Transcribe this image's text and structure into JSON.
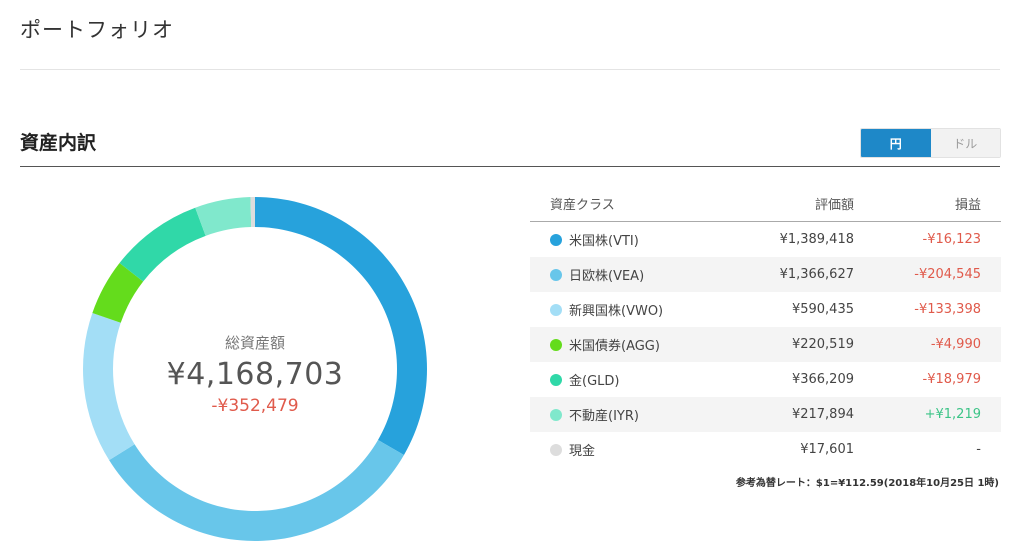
{
  "page": {
    "title": "ポートフォリオ"
  },
  "section": {
    "title": "資産内訳"
  },
  "currency_toggle": {
    "yen": "円",
    "dollar": "ドル",
    "selected": "円"
  },
  "summary": {
    "label": "総資産額",
    "total": "¥4,168,703",
    "profit_loss": "-¥352,479"
  },
  "table": {
    "headers": {
      "asset_class": "資産クラス",
      "value": "評価額",
      "profit_loss": "損益"
    },
    "rows": [
      {
        "name": "米国株(VTI)",
        "value": "¥1,389,418",
        "profit_loss": "-¥16,123",
        "color": "#27a2dc",
        "amount": 1389418,
        "pl_type": "neg"
      },
      {
        "name": "日欧株(VEA)",
        "value": "¥1,366,627",
        "profit_loss": "-¥204,545",
        "color": "#68c6ea",
        "amount": 1366627,
        "pl_type": "neg"
      },
      {
        "name": "新興国株(VWO)",
        "value": "¥590,435",
        "profit_loss": "-¥133,398",
        "color": "#a3def6",
        "amount": 590435,
        "pl_type": "neg"
      },
      {
        "name": "米国債券(AGG)",
        "value": "¥220,519",
        "profit_loss": "-¥4,990",
        "color": "#64dc1c",
        "amount": 220519,
        "pl_type": "neg"
      },
      {
        "name": "金(GLD)",
        "value": "¥366,209",
        "profit_loss": "-¥18,979",
        "color": "#30d8a8",
        "amount": 366209,
        "pl_type": "neg"
      },
      {
        "name": "不動産(IYR)",
        "value": "¥217,894",
        "profit_loss": "+¥1,219",
        "color": "#80e8cc",
        "amount": 217894,
        "pl_type": "pos"
      },
      {
        "name": "現金",
        "value": "¥17,601",
        "profit_loss": "-",
        "color": "#dddddd",
        "amount": 17601,
        "pl_type": "neu"
      }
    ]
  },
  "fx_note": "参考為替レート：$1=¥112.59(2018年10月25日 1時)"
}
